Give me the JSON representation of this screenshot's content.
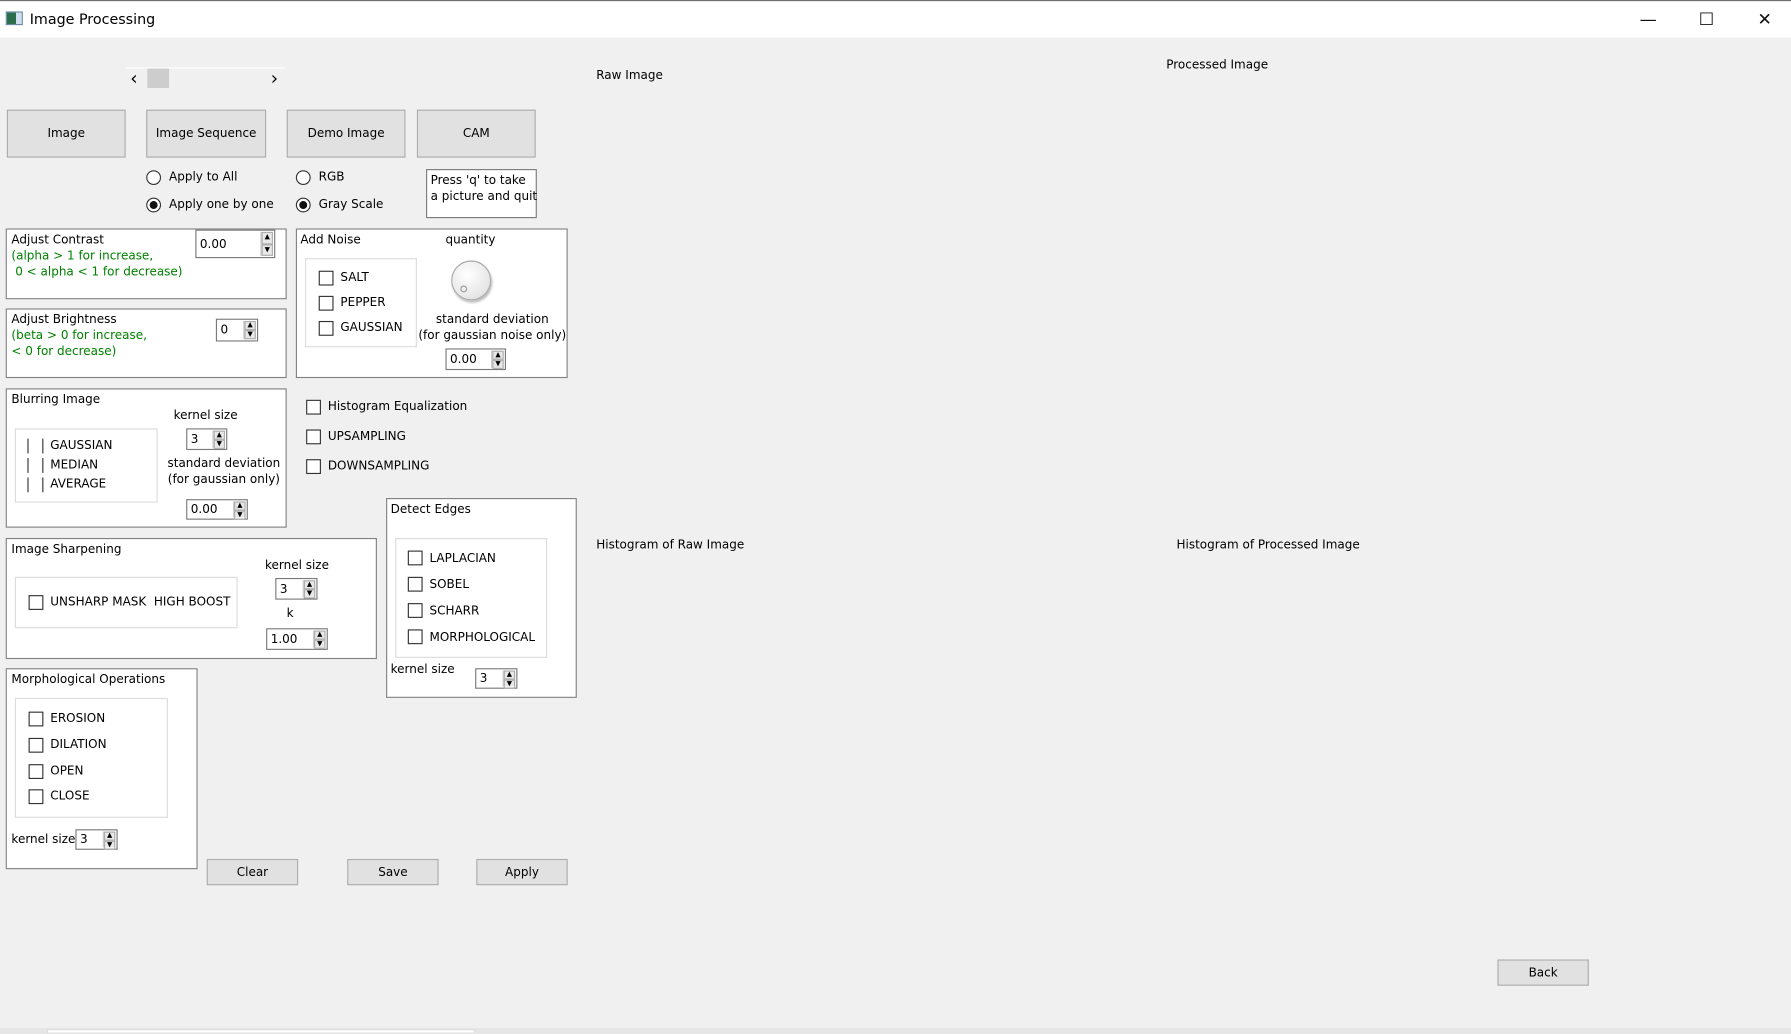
{
  "window": {
    "title": "Image Processing",
    "minimize": "—",
    "maximize": "☐",
    "close": "✕"
  },
  "navigator": {
    "prev": "‹",
    "next": "›"
  },
  "labels": {
    "raw_image": "Raw Image",
    "processed_image": "Processed Image",
    "hist_raw": "Histogram of Raw Image",
    "hist_processed": "Histogram of Processed Image"
  },
  "source_buttons": [
    "Image",
    "Image Sequence",
    "Demo Image",
    "CAM"
  ],
  "apply_mode": {
    "options": [
      "Apply to All",
      "Apply one by one"
    ],
    "selected": 1
  },
  "color_mode": {
    "options": [
      "RGB",
      "Gray Scale"
    ],
    "selected": 1
  },
  "cam_hint": [
    "Press 'q' to take",
    "a picture and quit"
  ],
  "contrast": {
    "title": "Adjust Contrast",
    "hint1": "(alpha > 1 for increase,",
    "hint2": " 0 < alpha < 1 for decrease)",
    "value": "0.00"
  },
  "brightness": {
    "title": "Adjust Brightness",
    "hint1": "(beta > 0 for increase,",
    "hint2": "< 0 for decrease)",
    "value": "0"
  },
  "noise": {
    "title": "Add Noise",
    "options": [
      "SALT",
      "PEPPER",
      "GAUSSIAN"
    ],
    "quantity_label": "quantity",
    "std_label1": "standard deviation",
    "std_label2": "(for gaussian noise only)",
    "std_value": "0.00"
  },
  "blur": {
    "title": "Blurring Image",
    "options": [
      "GAUSSIAN",
      "MEDIAN",
      "AVERAGE"
    ],
    "kernel_label": "kernel size",
    "kernel_value": "3",
    "std_label1": "standard deviation",
    "std_label2": "(for gaussian only)",
    "std_value": "0.00"
  },
  "toggles": [
    "Histogram Equalization",
    "UPSAMPLING",
    "DOWNSAMPLING"
  ],
  "sharpen": {
    "title": "Image Sharpening",
    "option": "UNSHARP MASK  HIGH BOOST",
    "kernel_label": "kernel size",
    "kernel_value": "3",
    "k_label": "k",
    "k_value": "1.00"
  },
  "edges": {
    "title": "Detect Edges",
    "options": [
      "LAPLACIAN",
      "SOBEL",
      "SCHARR",
      "MORPHOLOGICAL"
    ],
    "kernel_label": "kernel size",
    "kernel_value": "3"
  },
  "morph": {
    "title": "Morphological Operations",
    "options": [
      "EROSION",
      "DILATION",
      "OPEN",
      "CLOSE"
    ],
    "kernel_label": "kernel size",
    "kernel_value": "3"
  },
  "actions": {
    "clear": "Clear",
    "save": "Save",
    "apply": "Apply",
    "back": "Back"
  },
  "spin_arrows": {
    "up": "▲",
    "down": "▼"
  }
}
